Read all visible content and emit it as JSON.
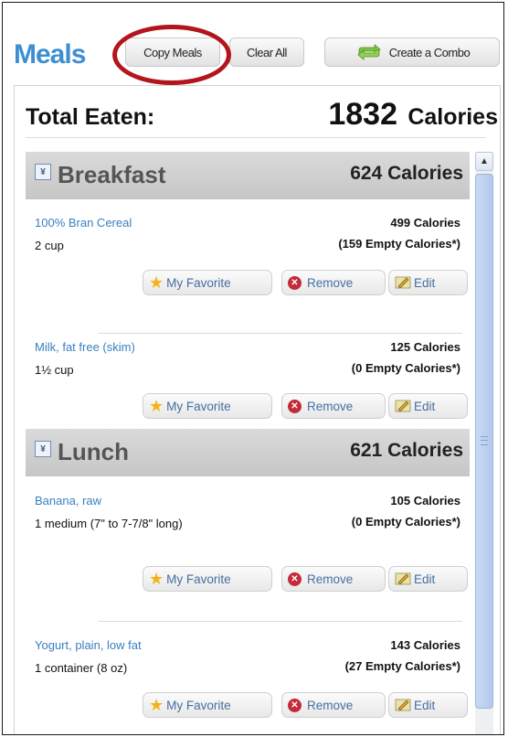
{
  "header": {
    "title": "Meals",
    "copy_label": "Copy Meals",
    "clear_label": "Clear All",
    "combo_label": "Create a Combo"
  },
  "total": {
    "label": "Total Eaten:",
    "value": "1832",
    "unit": "Calories"
  },
  "meals": [
    {
      "name": "Breakfast",
      "calories": "624 Calories",
      "items": [
        {
          "name": "100% Bran Cereal",
          "serving": "2 cup",
          "calories": "499 Calories",
          "empty": "(159 Empty Calories*)"
        },
        {
          "name": "Milk, fat free (skim)",
          "serving": "1½ cup",
          "calories": "125 Calories",
          "empty": "(0 Empty Calories*)"
        }
      ]
    },
    {
      "name": "Lunch",
      "calories": "621 Calories",
      "items": [
        {
          "name": "Banana, raw",
          "serving": "1 medium (7\" to 7-7/8\" long)",
          "calories": "105 Calories",
          "empty": "(0 Empty Calories*)"
        },
        {
          "name": "Yogurt, plain, low fat",
          "serving": "1 container (8 oz)",
          "calories": "143 Calories",
          "empty": "(27 Empty Calories*)"
        }
      ]
    }
  ],
  "actions": {
    "favorite": "My Favorite",
    "remove": "Remove",
    "edit": "Edit"
  },
  "icons": {
    "collapse": "collapse-icon",
    "star": "star-icon",
    "remove": "remove-x-icon",
    "edit": "pencil-icon",
    "combo": "cycle-arrows-icon"
  },
  "colors": {
    "title_blue": "#3d8fd1",
    "link_blue": "#3a7fc0",
    "highlight_circle": "#b3151d"
  }
}
